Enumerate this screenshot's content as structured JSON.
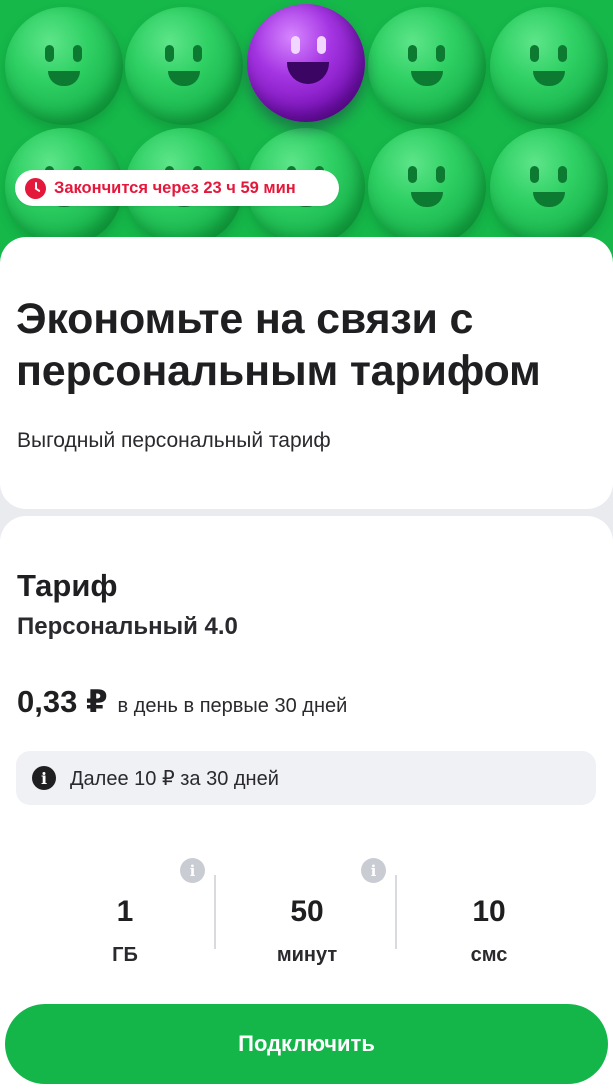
{
  "hero": {
    "timer_text": "Закончится через 23 ч 59 мин",
    "timer_icon": "clock-icon",
    "accent_color": "#14b64a",
    "alert_color": "#e4183b"
  },
  "offer": {
    "headline": "Экономьте на связи с персональным тарифом",
    "subtitle": "Выгодный персональный тариф"
  },
  "tariff": {
    "label": "Тариф",
    "name": "Персональный 4.0",
    "price": "0,33 ₽",
    "price_note": "в день в первые 30 дней",
    "info_text": "Далее 10 ₽ за 30 дней",
    "info_icon": "info-icon"
  },
  "stats": [
    {
      "value": "1",
      "unit": "ГБ",
      "has_info": true
    },
    {
      "value": "50",
      "unit": "минут",
      "has_info": true
    },
    {
      "value": "10",
      "unit": "смс",
      "has_info": false
    }
  ],
  "cta": {
    "label": "Подключить"
  }
}
